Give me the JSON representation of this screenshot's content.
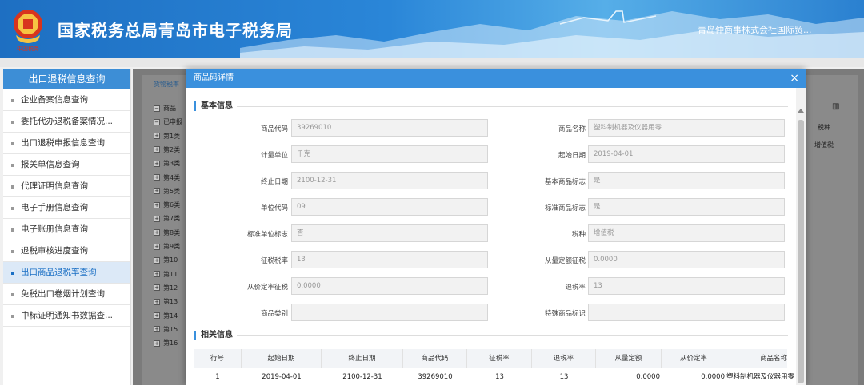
{
  "header": {
    "site_title": "国家税务总局青岛市电子税务局",
    "company": "青岛仲商事株式会社国际贸..."
  },
  "sidebar": {
    "title": "出口退税信息查询",
    "items": [
      {
        "label": "企业备案信息查询"
      },
      {
        "label": "委托代办退税备案情况..."
      },
      {
        "label": "出口退税申报信息查询"
      },
      {
        "label": "报关单信息查询"
      },
      {
        "label": "代理证明信息查询"
      },
      {
        "label": "电子手册信息查询"
      },
      {
        "label": "电子账册信息查询"
      },
      {
        "label": "退税审核进度查询"
      },
      {
        "label": "出口商品退税率查询"
      },
      {
        "label": "免税出口卷烟计划查询"
      },
      {
        "label": "中标证明通知书数据查..."
      }
    ],
    "active_index": 8
  },
  "background": {
    "tab_label": "货物税率",
    "tree_nodes": [
      "商品",
      "已申报",
      "第1类",
      "第2类",
      "第3类",
      "第4类",
      "第5类",
      "第6类",
      "第7类",
      "第8类",
      "第9类",
      "第10",
      "第11",
      "第12",
      "第13",
      "第14",
      "第15",
      "第16"
    ],
    "right_header": "税种",
    "right_value": "增值税"
  },
  "modal": {
    "title": "商品码详情",
    "close_glyph": "×",
    "basic_section": "基本信息",
    "fields": [
      {
        "label": "商品代码",
        "value": "39269010"
      },
      {
        "label": "商品名称",
        "value": "塑料制机器及仪器用零"
      },
      {
        "label": "计量单位",
        "value": "千克"
      },
      {
        "label": "起始日期",
        "value": "2019-04-01"
      },
      {
        "label": "终止日期",
        "value": "2100-12-31"
      },
      {
        "label": "基本商品标志",
        "value": "是"
      },
      {
        "label": "单位代码",
        "value": "09"
      },
      {
        "label": "标准商品标志",
        "value": "是"
      },
      {
        "label": "标准单位标志",
        "value": "否"
      },
      {
        "label": "税种",
        "value": "增值税"
      },
      {
        "label": "征税税率",
        "value": "13"
      },
      {
        "label": "从量定额征税",
        "value": "0.0000"
      },
      {
        "label": "从价定率征税",
        "value": "0.0000"
      },
      {
        "label": "退税率",
        "value": "13"
      },
      {
        "label": "商品类别",
        "value": ""
      },
      {
        "label": "特殊商品标识",
        "value": ""
      }
    ],
    "related_section": "相关信息",
    "table": {
      "headers": [
        "行号",
        "起始日期",
        "终止日期",
        "商品代码",
        "征税率",
        "退税率",
        "从量定额",
        "从价定率",
        "商品名称"
      ],
      "rows": [
        [
          "1",
          "2019-04-01",
          "2100-12-31",
          "39269010",
          "13",
          "13",
          "0.0000",
          "0.0000",
          "塑料制机器及仪器用零"
        ]
      ]
    }
  }
}
